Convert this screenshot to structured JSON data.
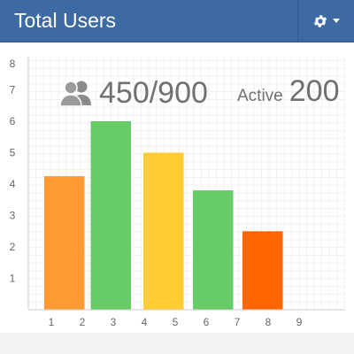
{
  "widget": {
    "title": "Total Users",
    "settings_icon": "gear-icon",
    "dropdown_icon": "caret-down-icon"
  },
  "stats": {
    "users_icon": "users-icon",
    "users_value": "450/900",
    "active_label": "Active",
    "active_value": "200"
  },
  "colors": {
    "header": "#3d6aa3",
    "text_gray": "#707070"
  },
  "chart_data": {
    "type": "bar",
    "title": "",
    "xlabel": "",
    "ylabel": "",
    "x_ticks": [
      "1",
      "2",
      "3",
      "4",
      "5",
      "6",
      "7",
      "8",
      "9"
    ],
    "y_ticks": [
      "1",
      "2",
      "3",
      "4",
      "5",
      "6",
      "7",
      "8"
    ],
    "xlim": [
      0.5,
      9.5
    ],
    "ylim": [
      0,
      8
    ],
    "grid": true,
    "bars": [
      {
        "x_start": 1,
        "x_end": 2.3,
        "value": 4.25,
        "color": "#ff9933"
      },
      {
        "x_start": 2.5,
        "x_end": 3.8,
        "value": 6.0,
        "color": "#66cc66"
      },
      {
        "x_start": 4.2,
        "x_end": 5.5,
        "value": 5.0,
        "color": "#ffcc33"
      },
      {
        "x_start": 5.8,
        "x_end": 7.1,
        "value": 3.8,
        "color": "#66cc66"
      },
      {
        "x_start": 7.4,
        "x_end": 8.7,
        "value": 2.5,
        "color": "#ff6600"
      }
    ]
  }
}
